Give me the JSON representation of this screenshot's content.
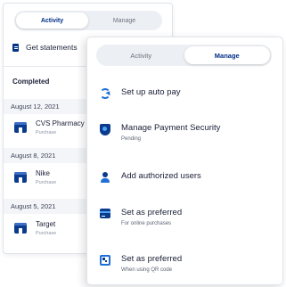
{
  "activity_card": {
    "tabs": [
      {
        "label": "Activity",
        "active": true
      },
      {
        "label": "Manage",
        "active": false
      }
    ],
    "get_statements": "Get statements",
    "section_title": "Completed",
    "transactions": [
      {
        "date": "August 12, 2021",
        "name": "CVS Pharmacy",
        "type": "Purchase"
      },
      {
        "date": "August 8, 2021",
        "name": "Nike",
        "type": "Purchase"
      },
      {
        "date": "August 5, 2021",
        "name": "Target",
        "type": "Purchase"
      }
    ]
  },
  "manage_card": {
    "tabs": [
      {
        "label": "Activity",
        "active": false
      },
      {
        "label": "Manage",
        "active": true
      }
    ],
    "items": [
      {
        "icon": "sync-icon",
        "title": "Set up auto pay",
        "subtitle": ""
      },
      {
        "icon": "shield-icon",
        "title": "Manage Payment Security",
        "subtitle": "Pending"
      },
      {
        "icon": "users-icon",
        "title": "Add authorized users",
        "subtitle": ""
      },
      {
        "icon": "card-icon",
        "title": "Set as preferred",
        "subtitle": "For online purchases"
      },
      {
        "icon": "qr-code-icon",
        "title": "Set as preferred",
        "subtitle": "When using QR code"
      }
    ]
  },
  "colors": {
    "brand_navy": "#003087",
    "accent_blue": "#1f6fd6",
    "date_row_bg": "#f3f5f8"
  }
}
